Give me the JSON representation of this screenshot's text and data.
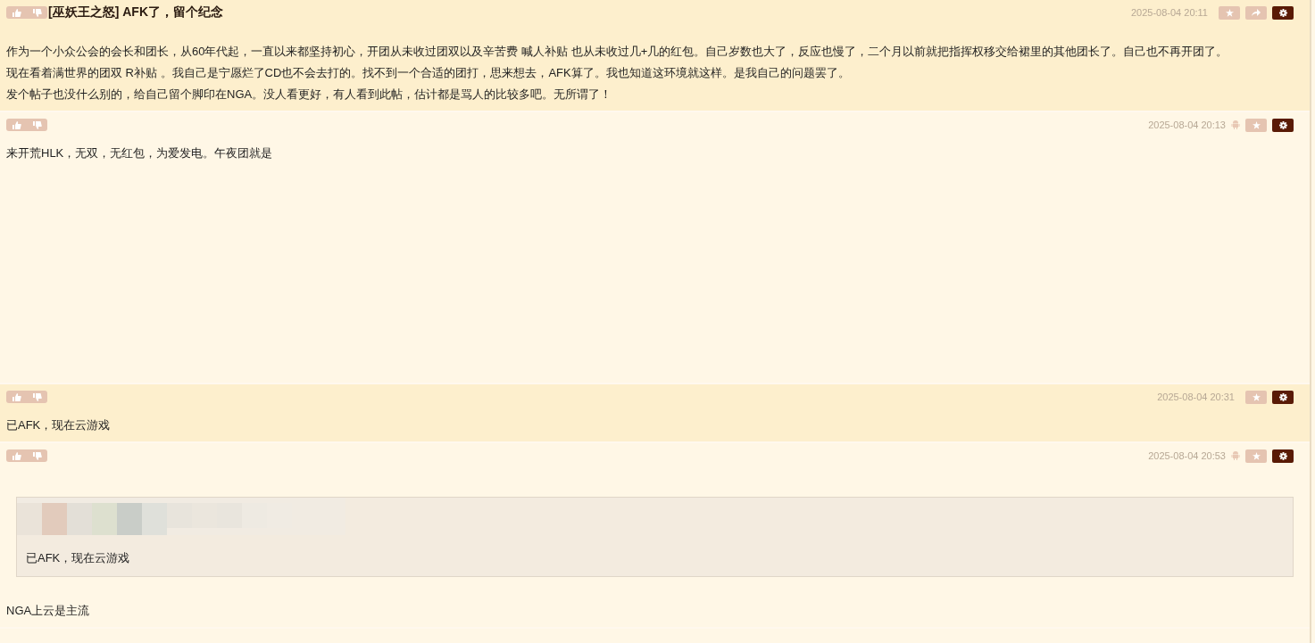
{
  "posts": [
    {
      "title": "[巫妖王之怒] AFK了，留个纪念",
      "time": "2025-08-04 20:11",
      "from_mobile": false,
      "shareable": true,
      "paragraphs": [
        "作为一个小众公会的会长和团长，从60年代起，一直以来都坚持初心，开团从未收过团双以及辛苦费 喊人补贴 也从未收过几+几的红包。自己岁数也大了，反应也慢了，二个月以前就把指挥权移交给裙里的其他团长了。自己也不再开团了。",
        "现在看着满世界的团双 R补贴 。我自己是宁愿烂了CD也不会去打的。找不到一个合适的团打，思来想去，AFK算了。我也知道这环境就这样。是我自己的问题罢了。",
        "发个帖子也没什么别的，给自己留个脚印在NGA。没人看更好，有人看到此帖，估计都是骂人的比较多吧。无所谓了！"
      ]
    },
    {
      "time": "2025-08-04 20:13",
      "from_mobile": true,
      "shareable": false,
      "paragraphs": [
        "来开荒HLK，无双，无红包，为爱发电。午夜团就是"
      ]
    },
    {
      "time": "2025-08-04 20:31",
      "from_mobile": false,
      "shareable": false,
      "paragraphs": [
        "已AFK，现在云游戏"
      ]
    },
    {
      "time": "2025-08-04 20:53",
      "from_mobile": true,
      "shareable": false,
      "quote": {
        "kind": "picture",
        "text": "已AFK，现在云游戏"
      },
      "paragraphs": [
        "NGA上云是主流"
      ]
    }
  ]
}
